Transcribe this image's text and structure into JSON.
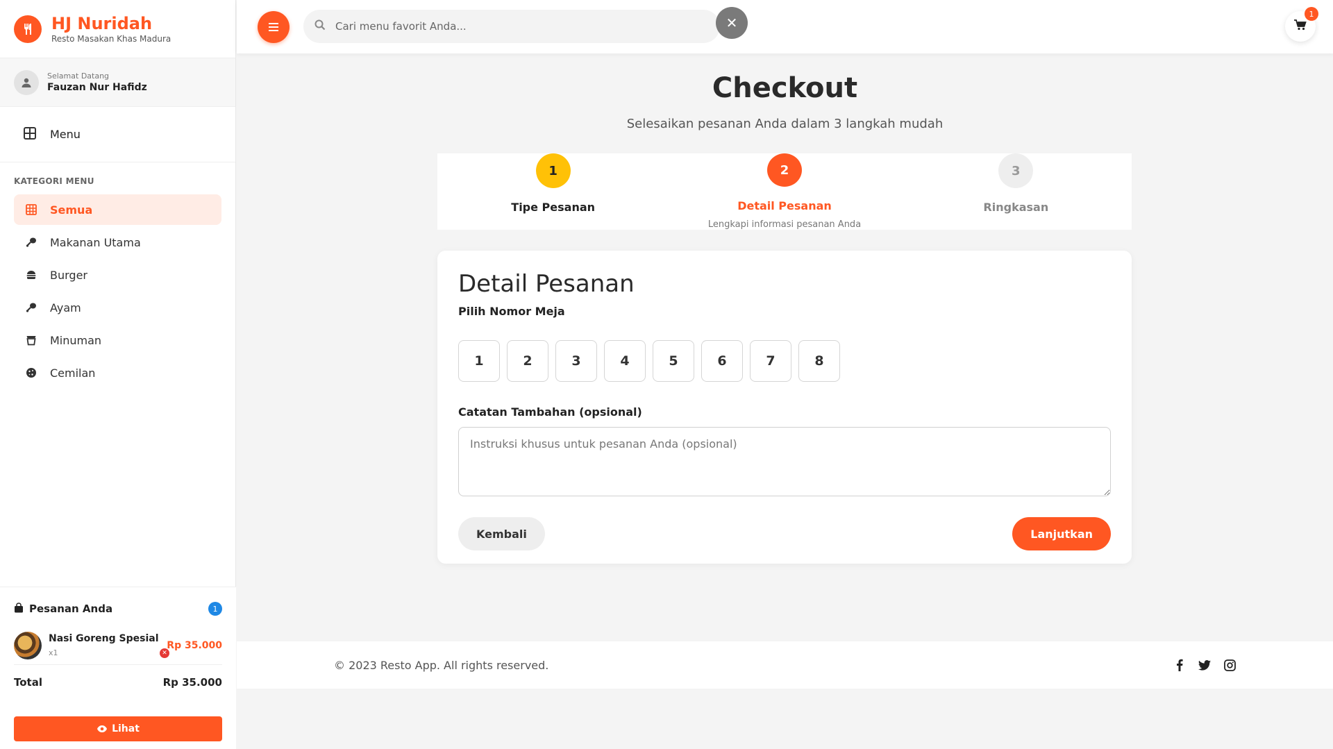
{
  "brand": {
    "title": "HJ Nuridah",
    "subtitle": "Resto Masakan Khas Madura"
  },
  "user": {
    "greeting": "Selamat Datang",
    "name": "Fauzan Nur Hafidz"
  },
  "nav": {
    "menu_label": "Menu"
  },
  "categories": {
    "heading": "KATEGORI MENU",
    "items": [
      {
        "label": "Semua",
        "icon": "grid-icon",
        "active": true
      },
      {
        "label": "Makanan Utama",
        "icon": "drumstick-icon",
        "active": false
      },
      {
        "label": "Burger",
        "icon": "burger-icon",
        "active": false
      },
      {
        "label": "Ayam",
        "icon": "drumstick-icon",
        "active": false
      },
      {
        "label": "Minuman",
        "icon": "mug-icon",
        "active": false
      },
      {
        "label": "Cemilan",
        "icon": "cookie-icon",
        "active": false
      }
    ]
  },
  "order_panel": {
    "title": "Pesanan Anda",
    "count": "1",
    "items": [
      {
        "name": "Nasi Goreng Spesial",
        "qty": "x1",
        "price": "Rp 35.000"
      }
    ],
    "total_label": "Total",
    "total_value": "Rp 35.000",
    "view_label": "Lihat"
  },
  "topbar": {
    "search_placeholder": "Cari menu favorit Anda...",
    "cart_count": "1"
  },
  "checkout": {
    "title": "Checkout",
    "subtitle": "Selesaikan pesanan Anda dalam 3 langkah mudah",
    "steps": [
      {
        "number": "1",
        "label": "Tipe Pesanan",
        "desc": "",
        "state": "done"
      },
      {
        "number": "2",
        "label": "Detail Pesanan",
        "desc": "Lengkapi informasi pesanan Anda",
        "state": "active"
      },
      {
        "number": "3",
        "label": "Ringkasan",
        "desc": "",
        "state": "pending"
      }
    ]
  },
  "form": {
    "title": "Detail Pesanan",
    "table_label": "Pilih Nomor Meja",
    "tables": [
      "1",
      "2",
      "3",
      "4",
      "5",
      "6",
      "7",
      "8"
    ],
    "notes_label": "Catatan Tambahan (opsional)",
    "notes_placeholder": "Instruksi khusus untuk pesanan Anda (opsional)",
    "back_label": "Kembali",
    "next_label": "Lanjutkan"
  },
  "footer": {
    "copyright": "© 2023 Resto App. All rights reserved."
  },
  "colors": {
    "accent": "#ff5722",
    "step_done": "#ffc107",
    "step_pending": "#eeeeee",
    "badge_blue": "#1e88e5"
  }
}
